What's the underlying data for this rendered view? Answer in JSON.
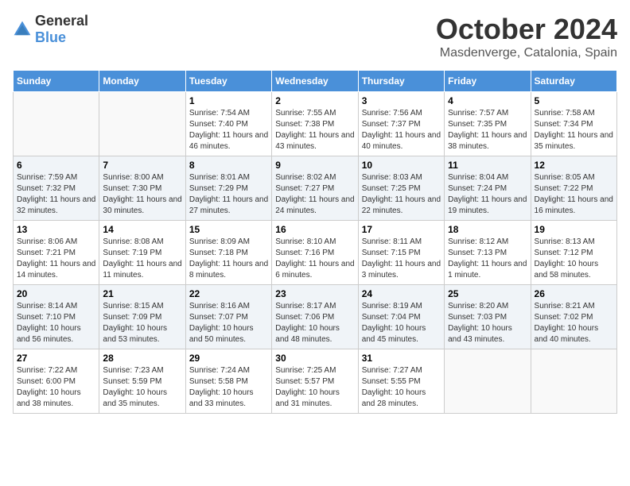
{
  "header": {
    "logo_general": "General",
    "logo_blue": "Blue",
    "month_title": "October 2024",
    "location": "Masdenverge, Catalonia, Spain"
  },
  "days_of_week": [
    "Sunday",
    "Monday",
    "Tuesday",
    "Wednesday",
    "Thursday",
    "Friday",
    "Saturday"
  ],
  "weeks": [
    {
      "alt": false,
      "days": [
        {
          "num": "",
          "empty": true
        },
        {
          "num": "",
          "empty": true
        },
        {
          "num": "1",
          "sunrise": "Sunrise: 7:54 AM",
          "sunset": "Sunset: 7:40 PM",
          "daylight": "Daylight: 11 hours and 46 minutes."
        },
        {
          "num": "2",
          "sunrise": "Sunrise: 7:55 AM",
          "sunset": "Sunset: 7:38 PM",
          "daylight": "Daylight: 11 hours and 43 minutes."
        },
        {
          "num": "3",
          "sunrise": "Sunrise: 7:56 AM",
          "sunset": "Sunset: 7:37 PM",
          "daylight": "Daylight: 11 hours and 40 minutes."
        },
        {
          "num": "4",
          "sunrise": "Sunrise: 7:57 AM",
          "sunset": "Sunset: 7:35 PM",
          "daylight": "Daylight: 11 hours and 38 minutes."
        },
        {
          "num": "5",
          "sunrise": "Sunrise: 7:58 AM",
          "sunset": "Sunset: 7:34 PM",
          "daylight": "Daylight: 11 hours and 35 minutes."
        }
      ]
    },
    {
      "alt": true,
      "days": [
        {
          "num": "6",
          "sunrise": "Sunrise: 7:59 AM",
          "sunset": "Sunset: 7:32 PM",
          "daylight": "Daylight: 11 hours and 32 minutes."
        },
        {
          "num": "7",
          "sunrise": "Sunrise: 8:00 AM",
          "sunset": "Sunset: 7:30 PM",
          "daylight": "Daylight: 11 hours and 30 minutes."
        },
        {
          "num": "8",
          "sunrise": "Sunrise: 8:01 AM",
          "sunset": "Sunset: 7:29 PM",
          "daylight": "Daylight: 11 hours and 27 minutes."
        },
        {
          "num": "9",
          "sunrise": "Sunrise: 8:02 AM",
          "sunset": "Sunset: 7:27 PM",
          "daylight": "Daylight: 11 hours and 24 minutes."
        },
        {
          "num": "10",
          "sunrise": "Sunrise: 8:03 AM",
          "sunset": "Sunset: 7:25 PM",
          "daylight": "Daylight: 11 hours and 22 minutes."
        },
        {
          "num": "11",
          "sunrise": "Sunrise: 8:04 AM",
          "sunset": "Sunset: 7:24 PM",
          "daylight": "Daylight: 11 hours and 19 minutes."
        },
        {
          "num": "12",
          "sunrise": "Sunrise: 8:05 AM",
          "sunset": "Sunset: 7:22 PM",
          "daylight": "Daylight: 11 hours and 16 minutes."
        }
      ]
    },
    {
      "alt": false,
      "days": [
        {
          "num": "13",
          "sunrise": "Sunrise: 8:06 AM",
          "sunset": "Sunset: 7:21 PM",
          "daylight": "Daylight: 11 hours and 14 minutes."
        },
        {
          "num": "14",
          "sunrise": "Sunrise: 8:08 AM",
          "sunset": "Sunset: 7:19 PM",
          "daylight": "Daylight: 11 hours and 11 minutes."
        },
        {
          "num": "15",
          "sunrise": "Sunrise: 8:09 AM",
          "sunset": "Sunset: 7:18 PM",
          "daylight": "Daylight: 11 hours and 8 minutes."
        },
        {
          "num": "16",
          "sunrise": "Sunrise: 8:10 AM",
          "sunset": "Sunset: 7:16 PM",
          "daylight": "Daylight: 11 hours and 6 minutes."
        },
        {
          "num": "17",
          "sunrise": "Sunrise: 8:11 AM",
          "sunset": "Sunset: 7:15 PM",
          "daylight": "Daylight: 11 hours and 3 minutes."
        },
        {
          "num": "18",
          "sunrise": "Sunrise: 8:12 AM",
          "sunset": "Sunset: 7:13 PM",
          "daylight": "Daylight: 11 hours and 1 minute."
        },
        {
          "num": "19",
          "sunrise": "Sunrise: 8:13 AM",
          "sunset": "Sunset: 7:12 PM",
          "daylight": "Daylight: 10 hours and 58 minutes."
        }
      ]
    },
    {
      "alt": true,
      "days": [
        {
          "num": "20",
          "sunrise": "Sunrise: 8:14 AM",
          "sunset": "Sunset: 7:10 PM",
          "daylight": "Daylight: 10 hours and 56 minutes."
        },
        {
          "num": "21",
          "sunrise": "Sunrise: 8:15 AM",
          "sunset": "Sunset: 7:09 PM",
          "daylight": "Daylight: 10 hours and 53 minutes."
        },
        {
          "num": "22",
          "sunrise": "Sunrise: 8:16 AM",
          "sunset": "Sunset: 7:07 PM",
          "daylight": "Daylight: 10 hours and 50 minutes."
        },
        {
          "num": "23",
          "sunrise": "Sunrise: 8:17 AM",
          "sunset": "Sunset: 7:06 PM",
          "daylight": "Daylight: 10 hours and 48 minutes."
        },
        {
          "num": "24",
          "sunrise": "Sunrise: 8:19 AM",
          "sunset": "Sunset: 7:04 PM",
          "daylight": "Daylight: 10 hours and 45 minutes."
        },
        {
          "num": "25",
          "sunrise": "Sunrise: 8:20 AM",
          "sunset": "Sunset: 7:03 PM",
          "daylight": "Daylight: 10 hours and 43 minutes."
        },
        {
          "num": "26",
          "sunrise": "Sunrise: 8:21 AM",
          "sunset": "Sunset: 7:02 PM",
          "daylight": "Daylight: 10 hours and 40 minutes."
        }
      ]
    },
    {
      "alt": false,
      "days": [
        {
          "num": "27",
          "sunrise": "Sunrise: 7:22 AM",
          "sunset": "Sunset: 6:00 PM",
          "daylight": "Daylight: 10 hours and 38 minutes."
        },
        {
          "num": "28",
          "sunrise": "Sunrise: 7:23 AM",
          "sunset": "Sunset: 5:59 PM",
          "daylight": "Daylight: 10 hours and 35 minutes."
        },
        {
          "num": "29",
          "sunrise": "Sunrise: 7:24 AM",
          "sunset": "Sunset: 5:58 PM",
          "daylight": "Daylight: 10 hours and 33 minutes."
        },
        {
          "num": "30",
          "sunrise": "Sunrise: 7:25 AM",
          "sunset": "Sunset: 5:57 PM",
          "daylight": "Daylight: 10 hours and 31 minutes."
        },
        {
          "num": "31",
          "sunrise": "Sunrise: 7:27 AM",
          "sunset": "Sunset: 5:55 PM",
          "daylight": "Daylight: 10 hours and 28 minutes."
        },
        {
          "num": "",
          "empty": true
        },
        {
          "num": "",
          "empty": true
        }
      ]
    }
  ]
}
